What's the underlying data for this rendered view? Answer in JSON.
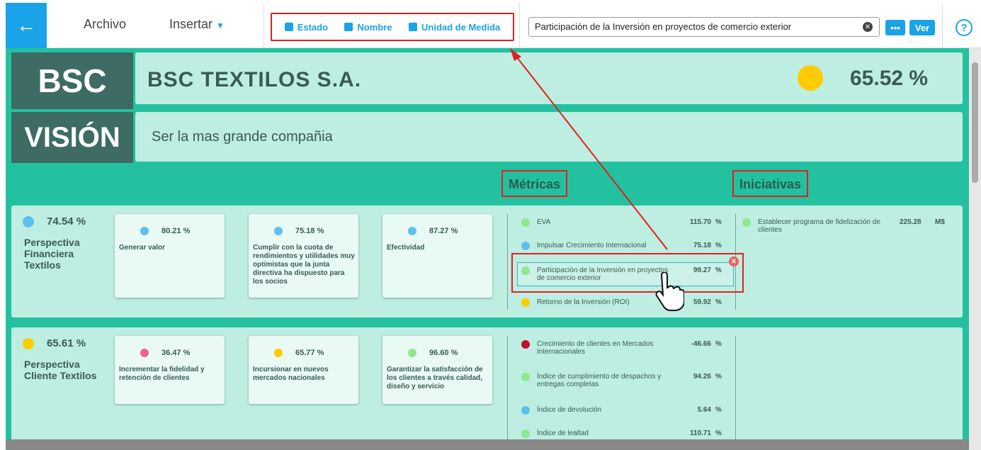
{
  "topbar": {
    "back_icon": "arrow-left-icon",
    "archivo": "Archivo",
    "insertar": "Insertar",
    "filters": [
      "Estado",
      "Nombre",
      "Unidad de Medida"
    ],
    "search_value": "Participación de la Inversión en proyectos de comercio exterior",
    "more_label": "•••",
    "ver_label": "Ver",
    "help_label": "?"
  },
  "header": {
    "bsc_label": "BSC",
    "company": "BSC TEXTILOS S.A.",
    "company_value": "65.52 %",
    "company_status_color": "#ffcc00",
    "vision_label": "VISIÓN",
    "vision_text": "Ser la mas grande compañia"
  },
  "sections": {
    "metricas": "Métricas",
    "iniciativas": "Iniciativas"
  },
  "perspectives": [
    {
      "value": "74.54",
      "unit": "%",
      "color": "#5bc0f0",
      "name": "Perspectiva Financiera Textilos",
      "objectives": [
        {
          "value": "80.21",
          "unit": "%",
          "color": "#5bc0f0",
          "name": "Generar valor"
        },
        {
          "value": "75.18",
          "unit": "%",
          "color": "#5bc0f0",
          "name": "Cumplir con la cuota de rendimientos y utilidades muy optimistas que la junta directiva ha dispuesto para los socios"
        },
        {
          "value": "87.27",
          "unit": "%",
          "color": "#5bc0f0",
          "name": "Efectividad"
        }
      ],
      "metrics": [
        {
          "name": "EVA",
          "value": "115.70",
          "unit": "%",
          "color": "#8ee88e"
        },
        {
          "name": "Impulsar Crecimiento Internacional",
          "value": "75.18",
          "unit": "%",
          "color": "#5bc0f0"
        },
        {
          "name": "Participación de la Inversión en proyectos de comercio exterior",
          "value": "99.27",
          "unit": "%",
          "color": "#8ee88e"
        },
        {
          "name": "Retorno de la Inversión (ROI)",
          "value": "59.92",
          "unit": "%",
          "color": "#ffcc00"
        }
      ],
      "initiatives": [
        {
          "name": "Establecer programa de fidelización de clientes",
          "value": "225.28",
          "unit": "M$",
          "color": "#8ee88e"
        }
      ]
    },
    {
      "value": "65.61",
      "unit": "%",
      "color": "#ffcc00",
      "name": "Perspectiva Cliente Textilos",
      "objectives": [
        {
          "value": "36.47",
          "unit": "%",
          "color": "#f06090",
          "name": "Incrementar la fidelidad y retención de clientes"
        },
        {
          "value": "65.77",
          "unit": "%",
          "color": "#ffcc00",
          "name": "Incursionar en nuevos mercados nacionales"
        },
        {
          "value": "96.60",
          "unit": "%",
          "color": "#8ee88e",
          "name": "Garantizar la satisfacción de los clientes a través calidad, diseño y servicio"
        }
      ],
      "metrics": [
        {
          "name": "Crecimiento de clientes en Mercados Internacionales",
          "value": "-46.66",
          "unit": "%",
          "color": "#c0102a"
        },
        {
          "name": "Índice de cumplimiento de despachos y entregas completas",
          "value": "94.26",
          "unit": "%",
          "color": "#8ee88e"
        },
        {
          "name": "Índice de devolución",
          "value": "5.64",
          "unit": "%",
          "color": "#5bc0f0"
        },
        {
          "name": "Índice de lealtad",
          "value": "110.71",
          "unit": "%",
          "color": "#8ee88e"
        }
      ]
    }
  ]
}
